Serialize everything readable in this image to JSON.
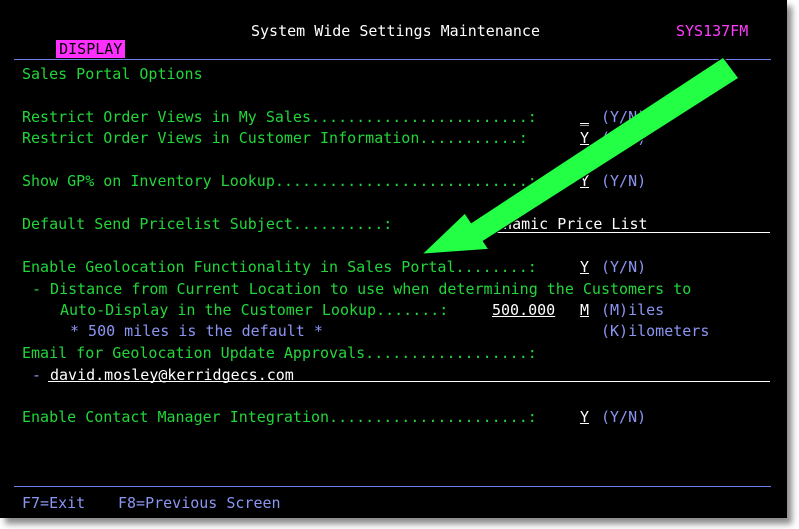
{
  "header": {
    "mode": "DISPLAY",
    "title": "System Wide Settings Maintenance",
    "program_id": "SYS137FM"
  },
  "section_title": "Sales Portal Options",
  "rows": {
    "restrict_my_sales": {
      "label": "Restrict Order Views in My Sales........................:",
      "value": "_",
      "hint": "(Y/N)"
    },
    "restrict_customer_info": {
      "label": "Restrict Order Views in Customer Information...........:",
      "value": "Y",
      "hint": "(Y/N)"
    },
    "show_gp": {
      "label": "Show GP% on Inventory Lookup............................:",
      "value": "Y",
      "hint": "(Y/N)"
    },
    "pricelist_subject": {
      "label": "Default Send Pricelist Subject..........:",
      "value": "Dynamic Price List"
    },
    "geolocation": {
      "label": "Enable Geolocation Functionality in Sales Portal........:",
      "value": "Y",
      "hint": "(Y/N)"
    },
    "distance_line1": "- Distance from Current Location to use when determining the Customers to",
    "distance_line2": "Auto-Display in the Customer Lookup.......:",
    "distance_value": "500.000",
    "distance_unit": "M",
    "unit_hint_miles": "(M)iles",
    "unit_hint_km": "(K)ilometers",
    "default_note": "* 500 miles is the default *",
    "email_label": "Email for Geolocation Update Approvals..................:",
    "email_prefix": "-",
    "email_value": "david.mosley@kerridgecs.com",
    "contact_manager": {
      "label": "Enable Contact Manager Integration......................:",
      "value": "Y",
      "hint": "(Y/N)"
    }
  },
  "footer": {
    "f7": "F7=Exit",
    "f8": "F8=Previous Screen"
  },
  "colors": {
    "background": "#000000",
    "label_green": "#22d63a",
    "hint_blue": "#8c96f2",
    "magenta": "#ff30ff",
    "arrow_green": "#22ff44"
  },
  "annotation": {
    "type": "green-arrow",
    "points_to": "pricelist_subject"
  }
}
